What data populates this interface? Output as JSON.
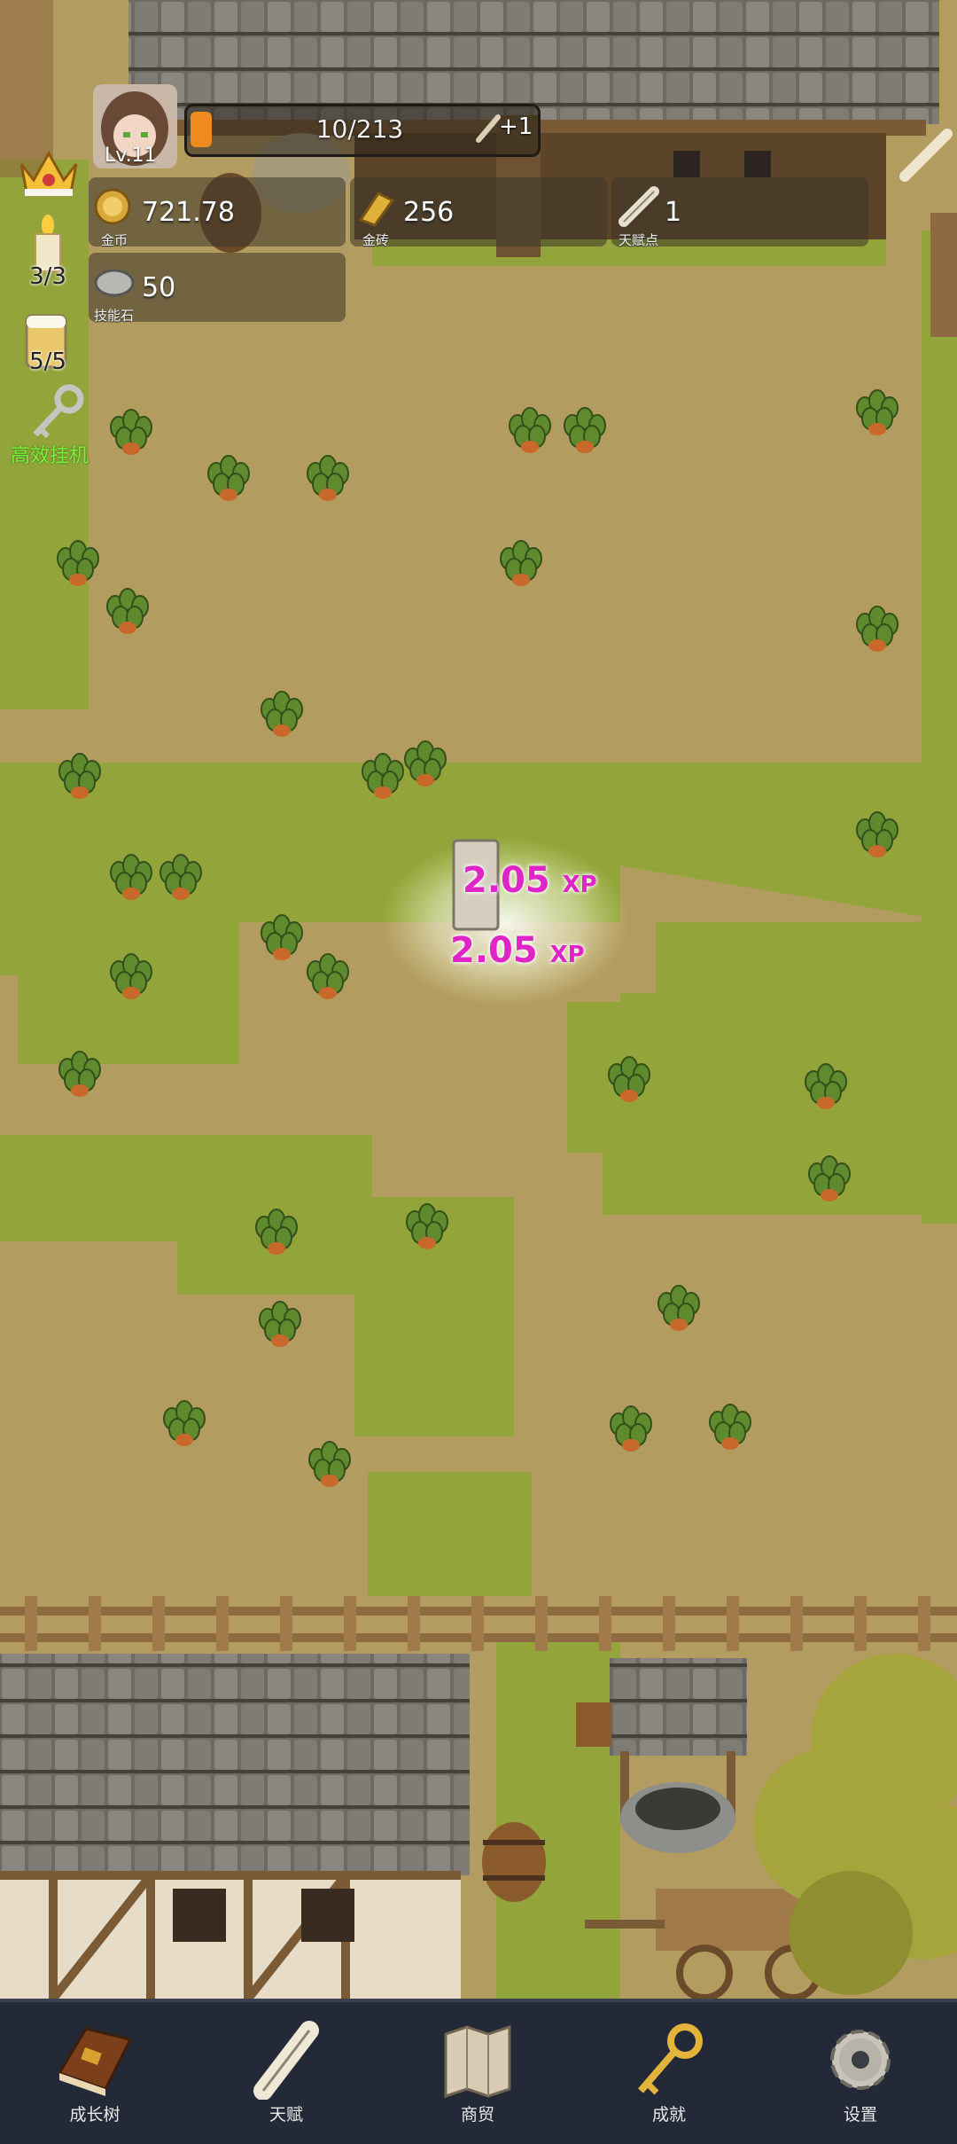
{
  "player": {
    "level": "Lv.11"
  },
  "xp_bar": {
    "text": "10/213",
    "bonus": "+1",
    "fill": 0.047
  },
  "resources": {
    "gold": {
      "value": "721.78",
      "label": "金币"
    },
    "gold_brick": {
      "value": "256",
      "label": "金砖"
    },
    "talent_points": {
      "value": "1",
      "label": "天赋点"
    },
    "skill_stone": {
      "value": "50",
      "label": "技能石"
    }
  },
  "side": {
    "candle_count": "3/3",
    "beer_count": "5/5",
    "auto_idle_label": "高效挂机"
  },
  "floating_xp": [
    {
      "value": "2.05",
      "unit": "XP"
    },
    {
      "value": "2.05",
      "unit": "XP"
    }
  ],
  "nav": [
    {
      "label": "成长树",
      "icon": "book-icon"
    },
    {
      "label": "天赋",
      "icon": "scroll-icon"
    },
    {
      "label": "商贸",
      "icon": "map-icon"
    },
    {
      "label": "成就",
      "icon": "key-icon"
    },
    {
      "label": "设置",
      "icon": "gear-icon"
    }
  ],
  "colors": {
    "dirt": "#b39c5f",
    "grass": "#93a53a",
    "nav_bg": "#232936",
    "xp_text": "#e025c8",
    "auto_idle": "#7cf23c"
  }
}
